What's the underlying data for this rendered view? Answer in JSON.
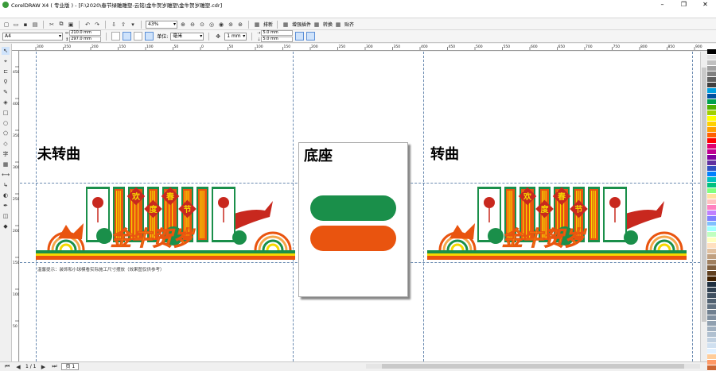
{
  "window": {
    "title": "CorelDRAW X4 ( 专业版 ) - [F:\\2020\\春节绿雕雕塑-云铭\\金牛贺岁雕塑\\金牛贺岁雕塑.cdr]",
    "controls": [
      "–",
      "❐",
      "✕"
    ]
  },
  "toolbar1": {
    "zoom": "43%",
    "snap_label": "贴齐",
    "options_label": "排新",
    "plugin_label": "增强插件",
    "convert_label": "转换",
    "paste_label": "贴齐"
  },
  "toolbar2": {
    "page_size": "A4",
    "width": "210.0 mm",
    "height": "297.0 mm",
    "units_label": "单位:",
    "units": "毫米",
    "nudge": "1 mm",
    "dup_x": "5.0 mm",
    "dup_y": "5.0 mm"
  },
  "ruler": {
    "top_ticks": [
      "300",
      "250",
      "200",
      "150",
      "100",
      "50",
      "0",
      "50",
      "100",
      "150",
      "200",
      "250",
      "300",
      "350",
      "400",
      "450",
      "500",
      "550",
      "600",
      "650",
      "700",
      "750",
      "800",
      "850",
      "900"
    ],
    "left_ticks": [
      "450",
      "400",
      "350",
      "300",
      "250",
      "200",
      "150",
      "100",
      "50"
    ]
  },
  "canvas": {
    "left_label": "未转曲",
    "middle_label": "底座",
    "right_label": "转曲",
    "banner_chars": [
      "欢",
      "度",
      "春",
      "节"
    ],
    "slogan": "金牛贺岁",
    "note": "温馨提示：装饰和小球模看实际施工尺寸摆放（效果图仅供参考）"
  },
  "status": {
    "page_count": "1 / 1",
    "page_tab": "页 1"
  },
  "colors": {
    "green": "#1a8f4a",
    "orange": "#e9540f",
    "yellow": "#f5d800",
    "red": "#c8281e",
    "light_orange": "#f4a74a"
  },
  "palette": [
    "#ffffff",
    "#000000",
    "#e0e0e0",
    "#c0c0c0",
    "#a0a0a0",
    "#808080",
    "#606060",
    "#404040",
    "#00a0e0",
    "#0050a0",
    "#00a050",
    "#50b000",
    "#a0d000",
    "#ffff00",
    "#ffd000",
    "#ffa000",
    "#ff6000",
    "#ff0000",
    "#e00070",
    "#c00090",
    "#8000a0",
    "#6030a0",
    "#3050c0",
    "#0080ff",
    "#00c0c0",
    "#00c080",
    "#80ff80",
    "#ffe0a0",
    "#ffc0c0",
    "#ff80c0",
    "#c080ff",
    "#8080ff",
    "#80c0ff",
    "#a0ffff",
    "#c0ffc0",
    "#ffffc0",
    "#ffe0c0",
    "#e0c0a0",
    "#c0a080",
    "#a08060",
    "#806040",
    "#604020",
    "#402000",
    "#203040",
    "#304050",
    "#405060",
    "#506070",
    "#607080",
    "#708090",
    "#8090a0",
    "#90a0b0",
    "#a0b0c0",
    "#b0c0d0",
    "#c0d0e0",
    "#d0e0f0",
    "#e0f0ff",
    "#ffcc99",
    "#ff9966",
    "#cc6633"
  ]
}
